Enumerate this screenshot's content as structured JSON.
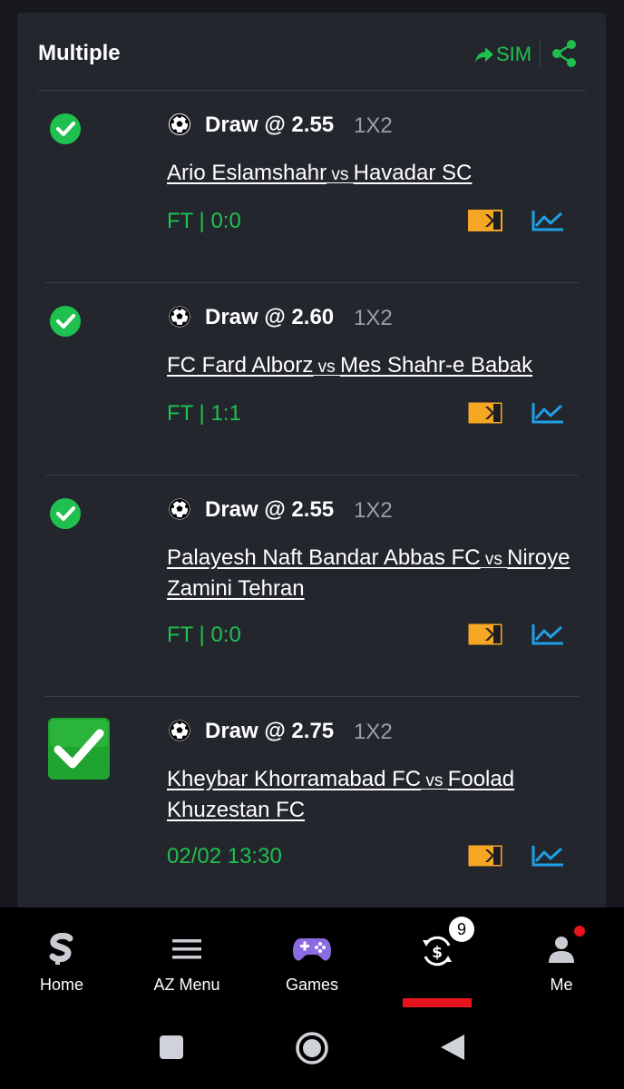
{
  "header": {
    "title": "Multiple",
    "sim_label": "SIM",
    "share_icon": "share-icon"
  },
  "bets": [
    {
      "settled_icon": "check-circle-icon",
      "pick": "Draw @ 2.55",
      "market": "1X2",
      "home": "Ario Eslamshahr",
      "vs": "vs",
      "away": "Havadar SC",
      "status": "FT | 0:0"
    },
    {
      "settled_icon": "check-circle-icon",
      "pick": "Draw @ 2.60",
      "market": "1X2",
      "home": "FC Fard Alborz",
      "vs": "vs",
      "away": "Mes Shahr-e Babak",
      "status": "FT | 1:1"
    },
    {
      "settled_icon": "check-circle-icon",
      "pick": "Draw @ 2.55",
      "market": "1X2",
      "home": "Palayesh Naft Bandar Abbas FC",
      "vs": "vs",
      "away": "Niroye Zamini Tehran",
      "status": "FT | 0:0"
    },
    {
      "settled_icon": "check-square-icon",
      "pick": "Draw @ 2.75",
      "market": "1X2",
      "home": "Kheybar Khorramabad FC",
      "vs": "vs",
      "away": "Foolad Khuzestan FC",
      "status": "02/02 13:30"
    }
  ],
  "nav": {
    "home": "Home",
    "az_menu": "AZ Menu",
    "games": "Games",
    "betslip_count": "9",
    "me": "Me"
  },
  "colors": {
    "accent_green": "#1fc04f",
    "accent_red": "#e8141d",
    "tv_orange": "#f5a623",
    "stats_blue": "#1ea0e6"
  }
}
